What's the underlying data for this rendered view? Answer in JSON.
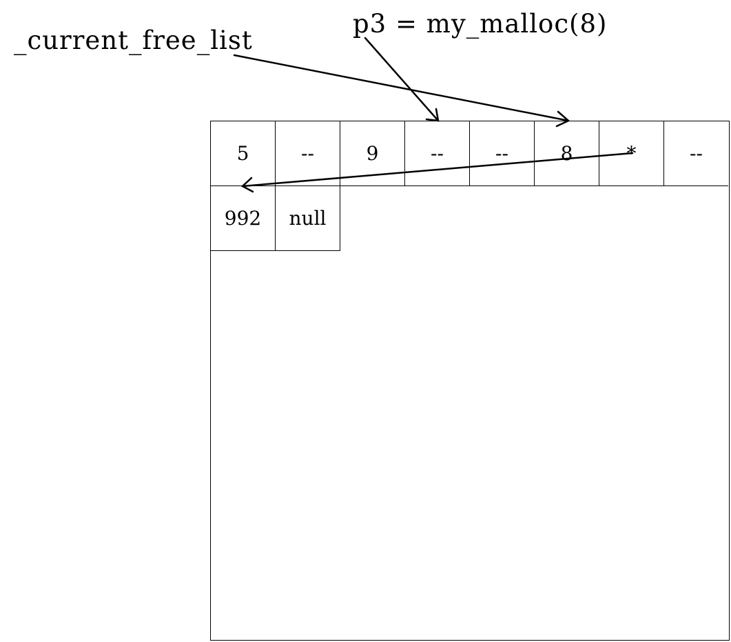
{
  "labels": {
    "current_free_list": "_current_free_list",
    "malloc_call": "p3 = my_malloc(8)"
  },
  "heap": {
    "row1": [
      "5",
      "--",
      "9",
      "--",
      "--",
      "8",
      "*",
      "--"
    ],
    "row2": [
      "992",
      "null"
    ]
  }
}
